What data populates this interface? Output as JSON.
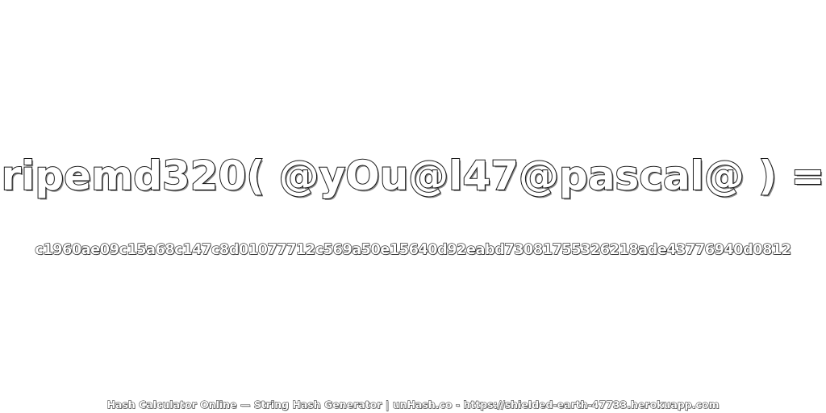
{
  "expression": "ripemd320( @yOu@l47@pascal@ ) =",
  "hash": "c1960ae09c15a68c147c8d01077712c569a50e15640d92eabd73081755326218ade43776940d0812",
  "footer": "Hash Calculator Online — String Hash Generator | unHash.co - https://shielded-earth-47733.herokuapp.com",
  "colors": {
    "background": "#ffffff",
    "text_fill": "#ffffff",
    "text_outline": "#1a1a1a"
  }
}
